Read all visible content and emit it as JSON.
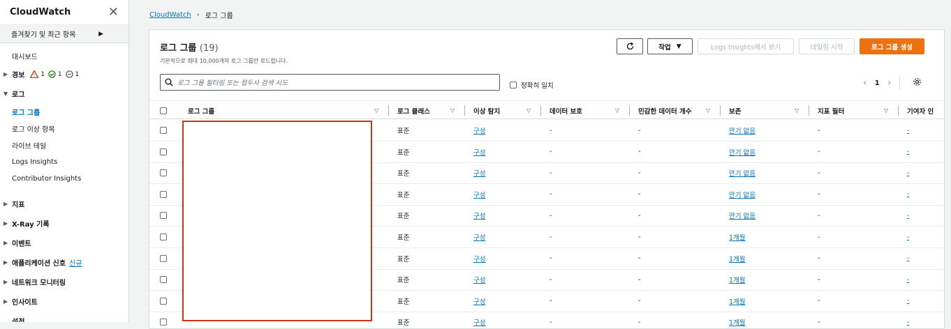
{
  "sidebar": {
    "title": "CloudWatch",
    "favorites": "즐겨찾기 및 최근 항목",
    "dashboards": "대시보드",
    "alarms": {
      "label": "경보",
      "alarm_count": "1",
      "ok_count": "1",
      "insufficient_count": "1"
    },
    "logs": {
      "label": "로그",
      "items": [
        "로그 그룹",
        "로그 이상 항목",
        "라이브 테일",
        "Logs Insights",
        "Contributor Insights"
      ]
    },
    "sections": [
      "지표",
      "X-Ray 기록",
      "이벤트",
      "애플리케이션 신호",
      "네트워크 모니터링",
      "인사이트",
      "설정"
    ],
    "new_tag": "신규"
  },
  "breadcrumb": {
    "root": "CloudWatch",
    "current": "로그 그룹"
  },
  "panel": {
    "title": "로그 그룹",
    "count": "(19)",
    "description": "기본적으로 최대 10,000개의 로그 그룹만 로드합니다.",
    "buttons": {
      "actions": "작업",
      "insights": "Logs Insights에서 보기",
      "tail": "테일링 시작",
      "create": "로그 그룹 생성"
    },
    "search_placeholder": "로그 그룹 필터링 또는 접두사 검색 시도",
    "exact_match": "정확히 일치",
    "page": "1"
  },
  "table": {
    "columns": [
      "로그 그룹",
      "로그 클래스",
      "이상 탐지",
      "데이터 보호",
      "민감한 데이터 개수",
      "보존",
      "지표 필터",
      "기여자 인"
    ],
    "rows": [
      {
        "class": "표준",
        "anomaly": "구성",
        "protection": "-",
        "sensitive": "-",
        "retention": "만기 없음",
        "metric": "-",
        "contrib": "-"
      },
      {
        "class": "표준",
        "anomaly": "구성",
        "protection": "-",
        "sensitive": "-",
        "retention": "만기 없음",
        "metric": "-",
        "contrib": "-"
      },
      {
        "class": "표준",
        "anomaly": "구성",
        "protection": "-",
        "sensitive": "-",
        "retention": "만기 없음",
        "metric": "-",
        "contrib": "-"
      },
      {
        "class": "표준",
        "anomaly": "구성",
        "protection": "-",
        "sensitive": "-",
        "retention": "만기 없음",
        "metric": "-",
        "contrib": "-"
      },
      {
        "class": "표준",
        "anomaly": "구성",
        "protection": "-",
        "sensitive": "-",
        "retention": "만기 없음",
        "metric": "-",
        "contrib": "-"
      },
      {
        "class": "표준",
        "anomaly": "구성",
        "protection": "-",
        "sensitive": "-",
        "retention": "1개월",
        "metric": "-",
        "contrib": "-"
      },
      {
        "class": "표준",
        "anomaly": "구성",
        "protection": "-",
        "sensitive": "-",
        "retention": "1개월",
        "metric": "-",
        "contrib": "-"
      },
      {
        "class": "표준",
        "anomaly": "구성",
        "protection": "-",
        "sensitive": "-",
        "retention": "1개월",
        "metric": "-",
        "contrib": "-"
      },
      {
        "class": "표준",
        "anomaly": "구성",
        "protection": "-",
        "sensitive": "-",
        "retention": "1개월",
        "metric": "-",
        "contrib": "-"
      },
      {
        "class": "표준",
        "anomaly": "구성",
        "protection": "-",
        "sensitive": "-",
        "retention": "1개월",
        "metric": "-",
        "contrib": "-"
      }
    ]
  },
  "colors": {
    "link": "#0073bb",
    "primary": "#ec7211",
    "redaction": "#d13212",
    "alarm": "#d13212",
    "ok": "#1d8102"
  }
}
